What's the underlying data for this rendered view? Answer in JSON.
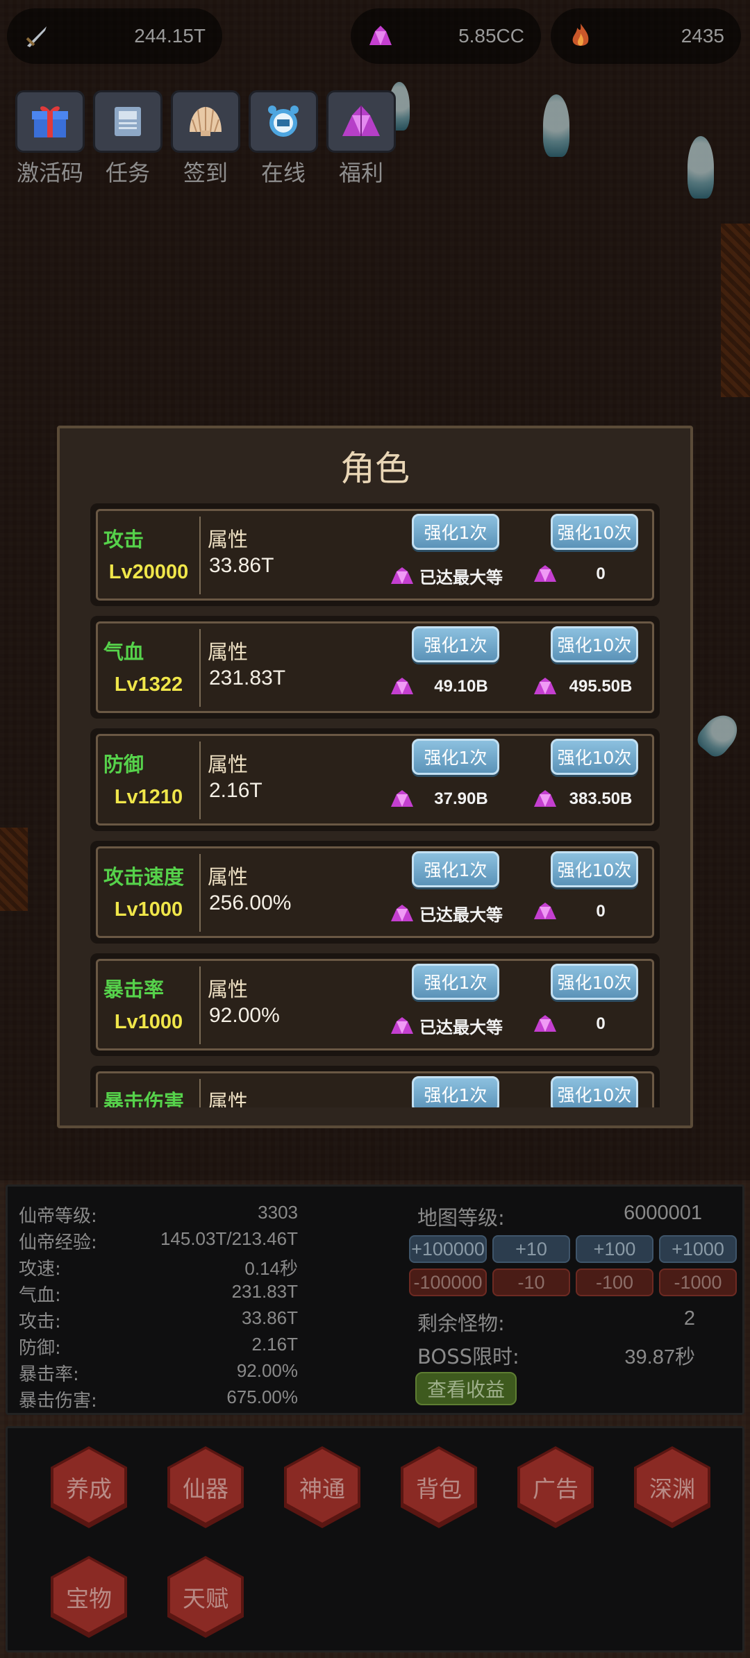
{
  "resources": [
    {
      "icon": "sword-icon",
      "value": "244.15T"
    },
    {
      "icon": "gem-icon",
      "value": "5.85CC"
    },
    {
      "icon": "flame-icon",
      "value": "2435"
    }
  ],
  "top_buttons": [
    {
      "icon": "gift-icon",
      "label": "激活码"
    },
    {
      "icon": "scroll-icon",
      "label": "任务"
    },
    {
      "icon": "shell-icon",
      "label": "签到"
    },
    {
      "icon": "alarm-clock-icon",
      "label": "在线"
    },
    {
      "icon": "crystal-icon",
      "label": "福利"
    }
  ],
  "panel": {
    "title": "角色",
    "attr_label": "属性",
    "btn1_label": "强化1次",
    "btn10_label": "强化10次",
    "rows": [
      {
        "name": "攻击",
        "level": "Lv20000",
        "value": "33.86T",
        "cost1": "已达最大等",
        "cost10": "0"
      },
      {
        "name": "气血",
        "level": "Lv1322",
        "value": "231.83T",
        "cost1": "49.10B",
        "cost10": "495.50B"
      },
      {
        "name": "防御",
        "level": "Lv1210",
        "value": "2.16T",
        "cost1": "37.90B",
        "cost10": "383.50B"
      },
      {
        "name": "攻击速度",
        "level": "Lv1000",
        "value": "256.00%",
        "cost1": "已达最大等",
        "cost10": "0"
      },
      {
        "name": "暴击率",
        "level": "Lv1000",
        "value": "92.00%",
        "cost1": "已达最大等",
        "cost10": "0"
      },
      {
        "name": "暴击伤害",
        "level": "",
        "value": "",
        "cost1": "",
        "cost10": ""
      }
    ]
  },
  "stats": [
    {
      "label": "仙帝等级:",
      "value": "3303"
    },
    {
      "label": "仙帝经验:",
      "value": "145.03T/213.46T"
    },
    {
      "label": "攻速:",
      "value": "0.14秒"
    },
    {
      "label": "气血:",
      "value": "231.83T"
    },
    {
      "label": "攻击:",
      "value": "33.86T"
    },
    {
      "label": "防御:",
      "value": "2.16T"
    },
    {
      "label": "暴击率:",
      "value": "92.00%"
    },
    {
      "label": "暴击伤害:",
      "value": "675.00%"
    }
  ],
  "map": {
    "level_label": "地图等级:",
    "level_value": "6000001",
    "up_buttons": [
      "+100000",
      "+10",
      "+100",
      "+1000"
    ],
    "down_buttons": [
      "-100000",
      "-10",
      "-100",
      "-1000"
    ],
    "remaining_label": "剩余怪物:",
    "remaining_value": "2",
    "boss_label": "BOSS限时:",
    "boss_value": "39.87秒",
    "profit_label": "查看收益"
  },
  "nav": [
    "养成",
    "仙器",
    "神通",
    "背包",
    "广告",
    "深渊",
    "宝物",
    "天赋"
  ]
}
